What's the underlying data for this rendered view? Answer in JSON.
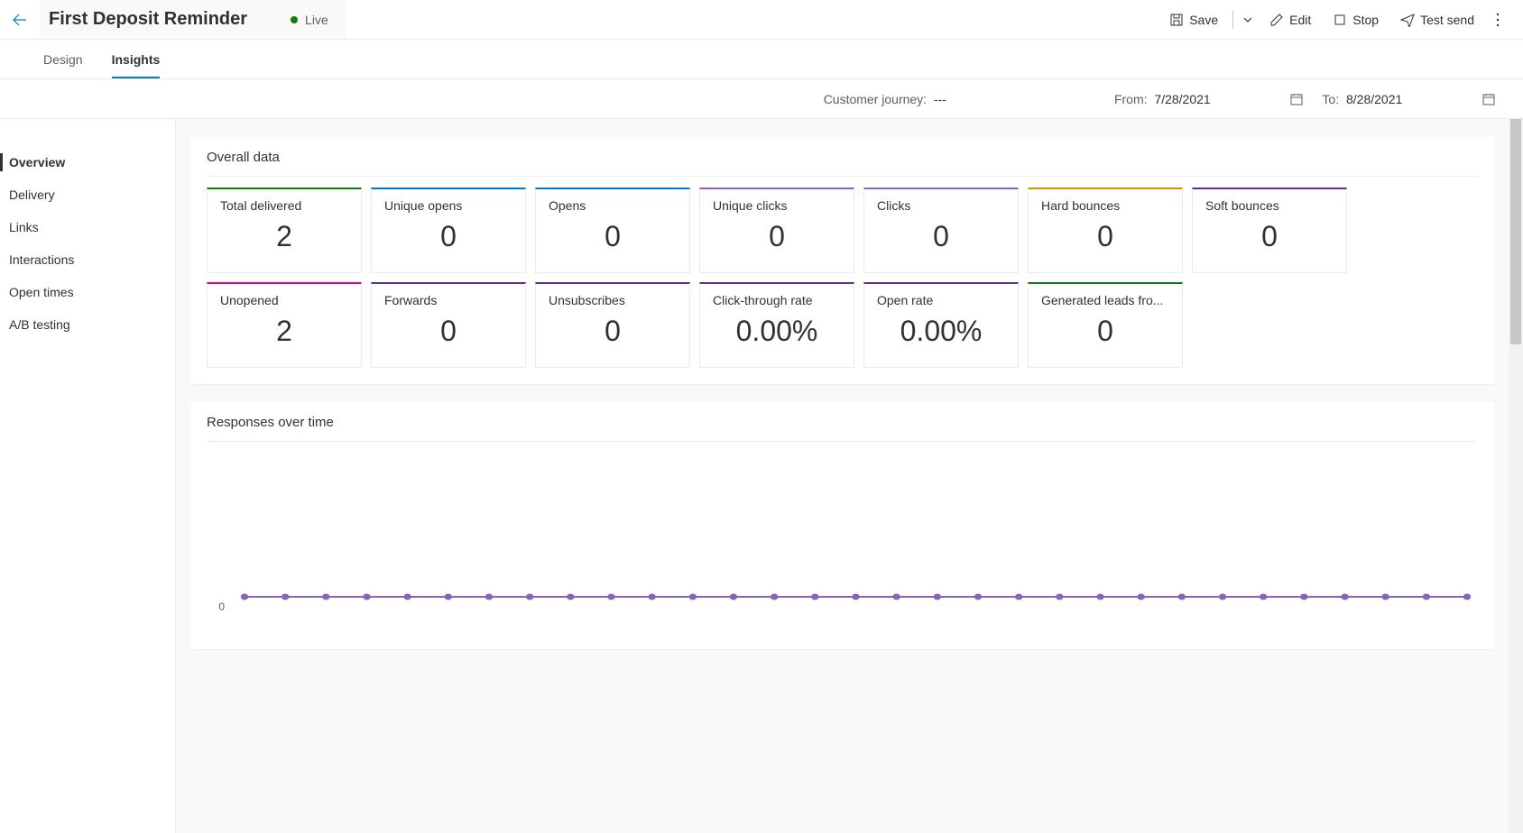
{
  "header": {
    "title": "First Deposit Reminder",
    "status": "Live",
    "actions": {
      "save": "Save",
      "edit": "Edit",
      "stop": "Stop",
      "test_send": "Test send"
    }
  },
  "tabs": {
    "design": "Design",
    "insights": "Insights"
  },
  "filter": {
    "journey_label": "Customer journey:",
    "journey_value": "---",
    "from_label": "From:",
    "from_value": "7/28/2021",
    "to_label": "To:",
    "to_value": "8/28/2021"
  },
  "sidebar": {
    "items": [
      {
        "label": "Overview",
        "active": true
      },
      {
        "label": "Delivery"
      },
      {
        "label": "Links"
      },
      {
        "label": "Interactions"
      },
      {
        "label": "Open times"
      },
      {
        "label": "A/B testing"
      }
    ]
  },
  "overall": {
    "title": "Overall data",
    "cards": [
      {
        "label": "Total delivered",
        "value": "2",
        "color": "#107c10"
      },
      {
        "label": "Unique opens",
        "value": "0",
        "color": "#0078d4"
      },
      {
        "label": "Opens",
        "value": "0",
        "color": "#0078d4"
      },
      {
        "label": "Unique clicks",
        "value": "0",
        "color": "#8764b8"
      },
      {
        "label": "Clicks",
        "value": "0",
        "color": "#8764b8"
      },
      {
        "label": "Hard bounces",
        "value": "0",
        "color": "#d29200"
      },
      {
        "label": "Soft bounces",
        "value": "0",
        "color": "#5c2e91"
      },
      {
        "label": "Unopened",
        "value": "2",
        "color": "#e3008c"
      },
      {
        "label": "Forwards",
        "value": "0",
        "color": "#5c2e91"
      },
      {
        "label": "Unsubscribes",
        "value": "0",
        "color": "#5c2e91"
      },
      {
        "label": "Click-through rate",
        "value": "0.00%",
        "color": "#5c2e91"
      },
      {
        "label": "Open rate",
        "value": "0.00%",
        "color": "#5c2e91"
      },
      {
        "label": "Generated leads fro...",
        "value": "0",
        "color": "#107c10"
      }
    ]
  },
  "responses": {
    "title": "Responses over time",
    "ylabel": "0"
  },
  "chart_data": {
    "type": "line",
    "title": "Responses over time",
    "xlabel": "",
    "ylabel": "",
    "ylim": [
      0,
      1
    ],
    "series": [
      {
        "name": "Responses",
        "values": [
          0,
          0,
          0,
          0,
          0,
          0,
          0,
          0,
          0,
          0,
          0,
          0,
          0,
          0,
          0,
          0,
          0,
          0,
          0,
          0,
          0,
          0,
          0,
          0,
          0,
          0,
          0,
          0,
          0,
          0,
          0
        ]
      }
    ]
  }
}
